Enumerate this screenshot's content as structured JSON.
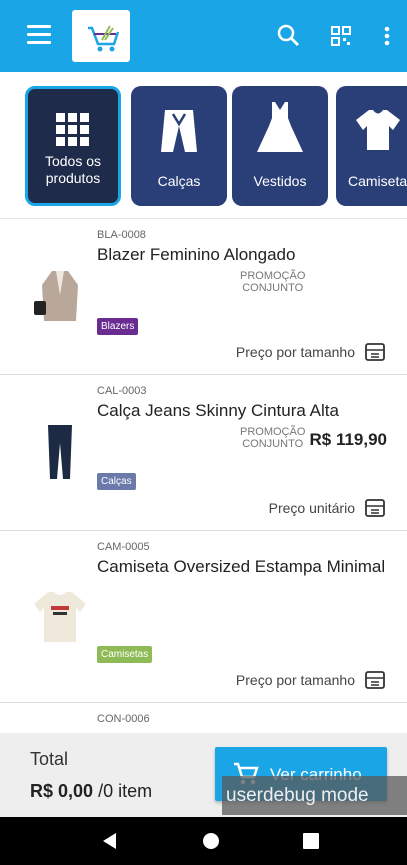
{
  "debug_overlay": "userdebug mode",
  "categories": [
    {
      "label": "Todos os produtos"
    },
    {
      "label": "Calças"
    },
    {
      "label": "Vestidos"
    },
    {
      "label": "Camiseta"
    }
  ],
  "products": [
    {
      "sku": "BLA-0008",
      "name": "Blazer Feminino Alongado",
      "promo1": "PROMOÇÃO",
      "promo2": "CONJUNTO",
      "price": "",
      "tag": "Blazers",
      "tag_color": "#6a2c91",
      "price_type": "Preço por tamanho"
    },
    {
      "sku": "CAL-0003",
      "name": "Calça Jeans Skinny Cintura Alta",
      "promo1": "PROMOÇÃO",
      "promo2": "CONJUNTO",
      "price": "R$ 119,90",
      "tag": "Calças",
      "tag_color": "#6b7aab",
      "price_type": "Preço unitário"
    },
    {
      "sku": "CAM-0005",
      "name": "Camiseta Oversized Estampa Minimal",
      "promo1": "",
      "promo2": "",
      "price": "",
      "tag": "Camisetas",
      "tag_color": "#8fbb56",
      "price_type": "Preço por tamanho"
    },
    {
      "sku": "CON-0006"
    }
  ],
  "footer": {
    "total_label": "Total",
    "total_value": "R$ 0,00",
    "total_items": "/0 item",
    "cart_button": "Ver carrinho"
  },
  "colors": {
    "accent": "#1aa5e6",
    "category_bg": "#2a3f78"
  }
}
